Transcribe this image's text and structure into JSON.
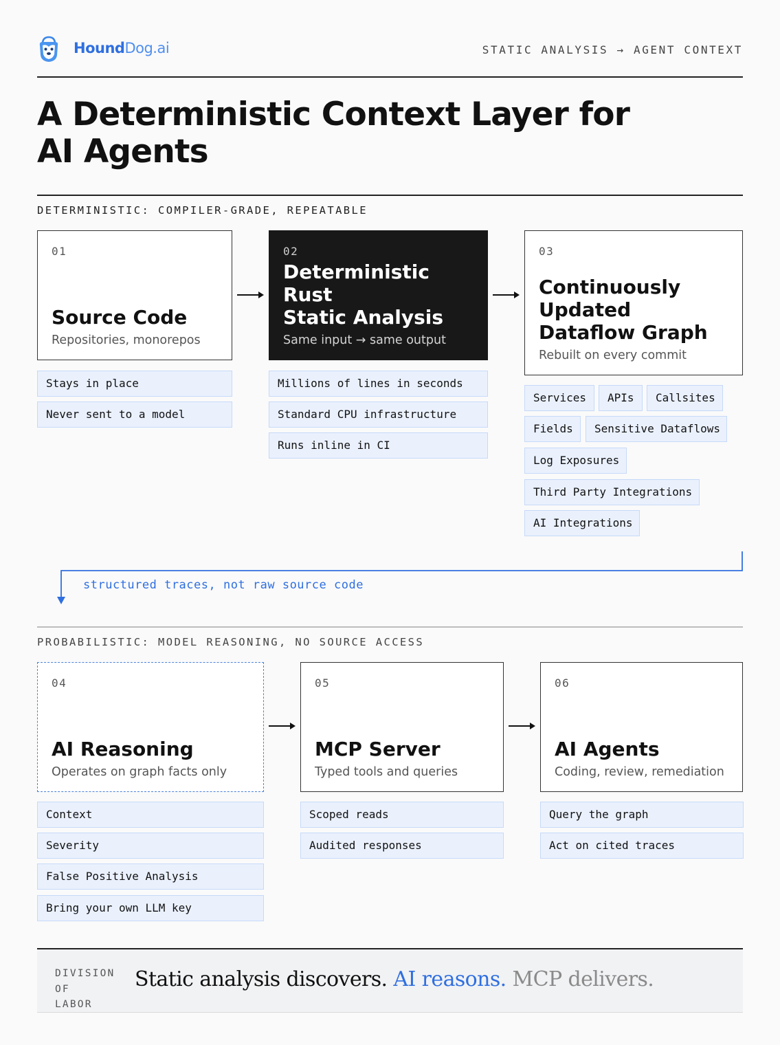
{
  "header": {
    "brand_bold": "Hound",
    "brand_light": "Dog.ai",
    "tagline": "STATIC ANALYSIS → AGENT CONTEXT"
  },
  "title": {
    "line1": "A Deterministic Context Layer for",
    "line2": "AI Agents"
  },
  "deterministic": {
    "label": "DETERMINISTIC: COMPILER-GRADE, REPEATABLE",
    "stages": [
      {
        "num": "01",
        "title": "Source Code",
        "subtitle": "Repositories, monorepos",
        "chips": [
          "Stays in place",
          "Never sent to a model"
        ]
      },
      {
        "num": "02",
        "title_line1": "Deterministic Rust",
        "title_line2": "Static Analysis",
        "subtitle": "Same input → same output",
        "chips": [
          "Millions of lines in seconds",
          "Standard CPU infrastructure",
          "Runs inline in CI"
        ]
      },
      {
        "num": "03",
        "title_line1": "Continuously",
        "title_line2": "Updated",
        "title_line3": "Dataflow Graph",
        "subtitle": "Rebuilt on every commit",
        "chips": [
          "Services",
          "APIs",
          "Callsites",
          "Fields",
          "Sensitive Dataflows",
          "Log Exposures",
          "Third Party Integrations",
          "AI Integrations"
        ]
      }
    ]
  },
  "connector": {
    "text": "structured traces, not raw source code"
  },
  "probabilistic": {
    "label": "PROBABILISTIC: MODEL REASONING, NO SOURCE ACCESS",
    "stages": [
      {
        "num": "04",
        "title": "AI Reasoning",
        "subtitle": "Operates on graph facts only",
        "chips": [
          "Context",
          "Severity",
          "False Positive Analysis",
          "Bring your own LLM key"
        ]
      },
      {
        "num": "05",
        "title": "MCP Server",
        "subtitle": "Typed tools and queries",
        "chips": [
          "Scoped reads",
          "Audited responses"
        ]
      },
      {
        "num": "06",
        "title": "AI Agents",
        "subtitle": "Coding, review, remediation",
        "chips": [
          "Query the graph",
          "Act on cited traces"
        ]
      }
    ]
  },
  "footer": {
    "label_line1": "DIVISION",
    "label_line2": "OF",
    "label_line3": "LABOR",
    "part1": "Static analysis discovers.",
    "part2": "AI reasons.",
    "part3": "MCP delivers."
  },
  "colors": {
    "accent": "#2f6fe0",
    "chip_bg": "#eaf1fd",
    "chip_border": "#c6d9f8",
    "dark_box": "#181818"
  }
}
